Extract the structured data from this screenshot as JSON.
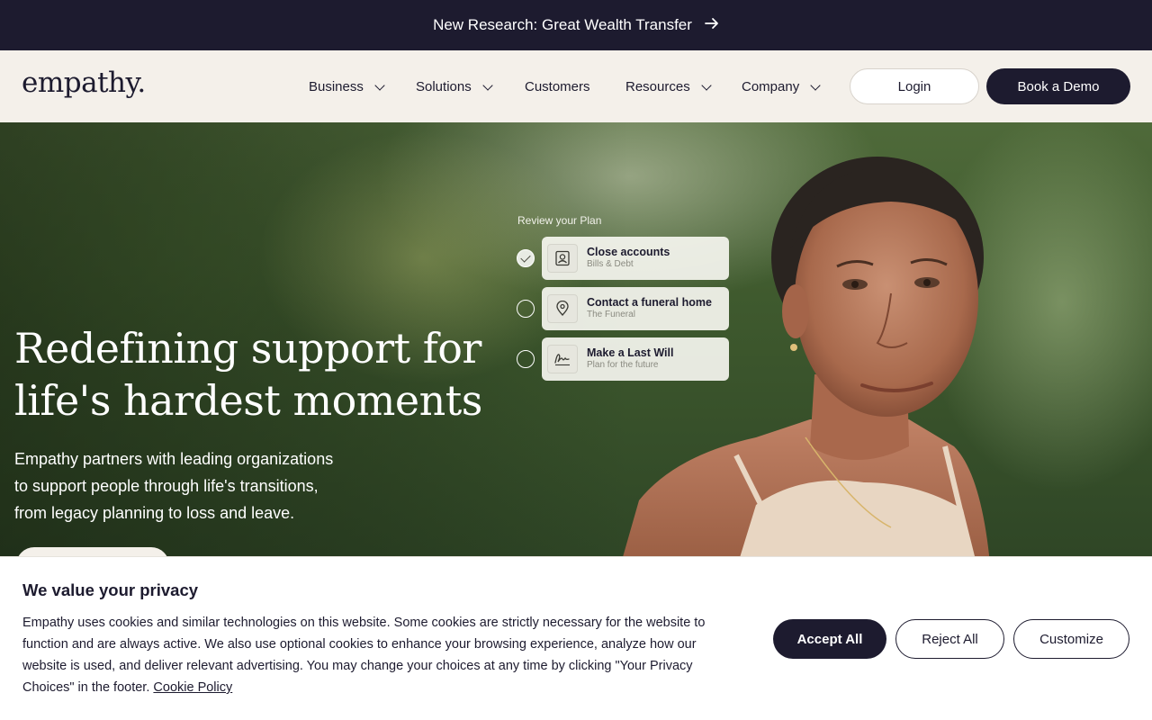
{
  "announcement": {
    "text": "New Research: Great Wealth Transfer",
    "arrow_icon": "arrow-right-icon"
  },
  "header": {
    "logo": "empathy.",
    "nav": [
      {
        "label": "Business",
        "has_dropdown": true
      },
      {
        "label": "Solutions",
        "has_dropdown": true
      },
      {
        "label": "Customers",
        "has_dropdown": false
      },
      {
        "label": "Resources",
        "has_dropdown": true
      },
      {
        "label": "Company",
        "has_dropdown": true
      }
    ],
    "login_label": "Login",
    "demo_label": "Book a Demo"
  },
  "hero": {
    "title_line1": "Redefining support for",
    "title_line2": "life's hardest moments",
    "sub_line1": "Empathy partners with leading organizations",
    "sub_line2": "to support people through life's transitions,",
    "sub_line3": "from legacy planning to loss and leave.",
    "plan": {
      "title": "Review your Plan",
      "items": [
        {
          "label": "Close accounts",
          "sub": "Bills & Debt",
          "done": true,
          "icon": "contact-card-icon"
        },
        {
          "label": "Contact a funeral home",
          "sub": "The Funeral",
          "done": false,
          "icon": "location-pin-icon"
        },
        {
          "label": "Make a Last Will",
          "sub": "Plan for the future",
          "done": false,
          "icon": "signature-icon"
        }
      ]
    }
  },
  "cookie": {
    "title": "We value your privacy",
    "body": "Empathy uses cookies and similar technologies on this website. Some cookies are strictly necessary for the website to function and are always active. We also use optional cookies to enhance your browsing experience, analyze how our website is used, and deliver relevant advertising. You may change your choices at any time by clicking \"Your Privacy Choices\" in the footer.",
    "link": "Cookie Policy",
    "accept": "Accept All",
    "reject": "Reject All",
    "customize": "Customize"
  }
}
